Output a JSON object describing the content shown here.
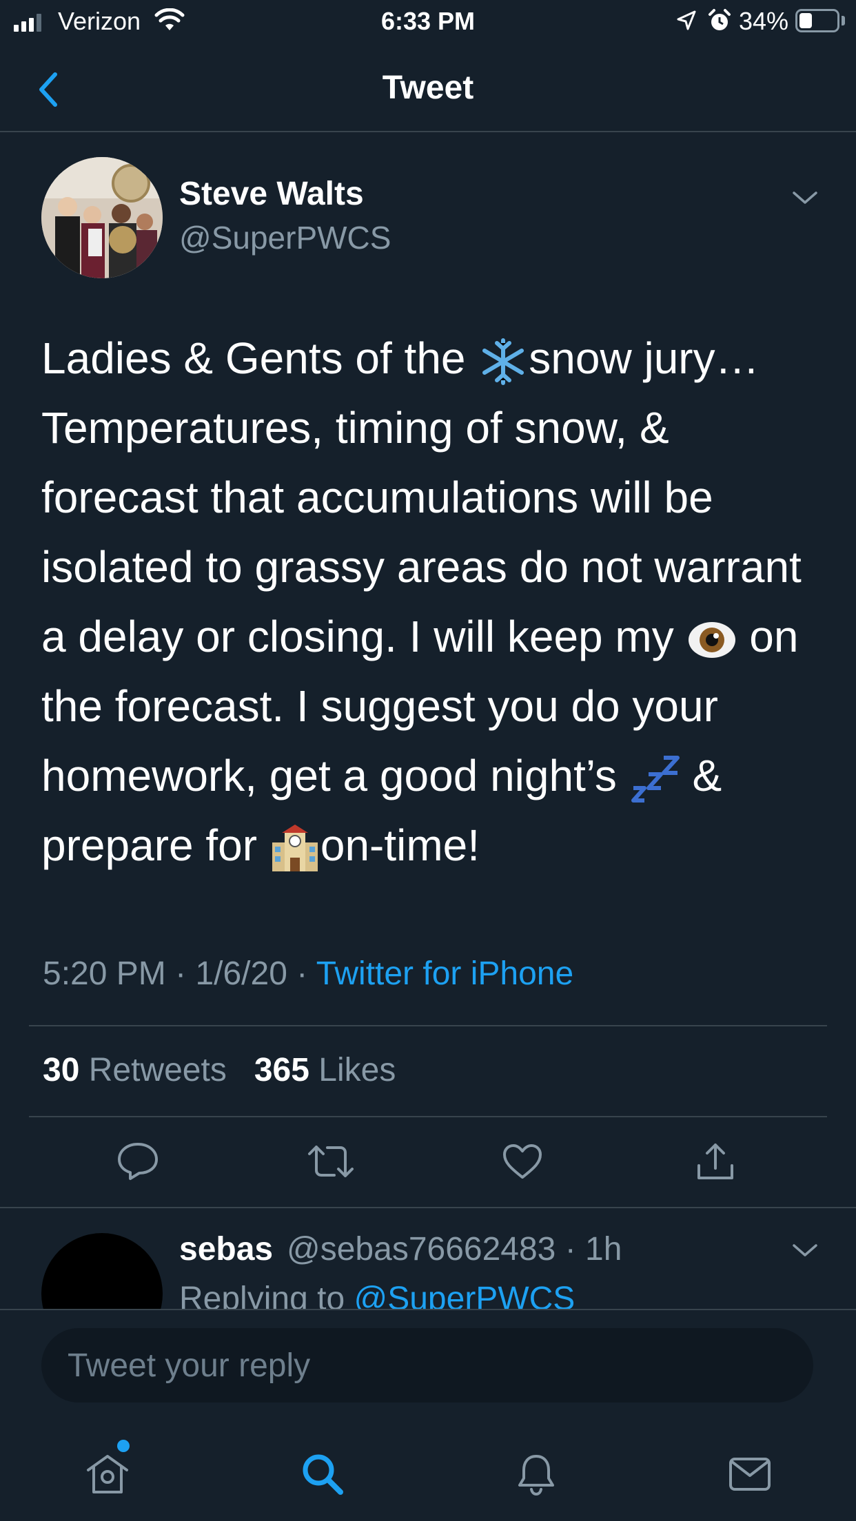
{
  "status_bar": {
    "carrier": "Verizon",
    "time": "6:33 PM",
    "battery_pct": "34%",
    "battery_level": 0.34
  },
  "nav": {
    "title": "Tweet"
  },
  "tweet": {
    "author_name": "Steve Walts",
    "author_handle": "@SuperPWCS",
    "text_parts": {
      "p1": "Ladies & Gents of the ",
      "p2": "snow jury…Temperatures, timing of snow, & forecast that accumulations will be isolated to grassy areas do not warrant a delay or closing. I will keep my ",
      "p3": " on the forecast. I suggest you do your homework, get a good night’s ",
      "p4": " & prepare for ",
      "p5": "on-time!"
    },
    "emojis": [
      "snowflake-emoji",
      "eye-emoji",
      "zzz-emoji",
      "school-emoji"
    ],
    "time": "5:20 PM",
    "date": "1/6/20",
    "separator": "·",
    "source": "Twitter for iPhone",
    "retweets_count": "30",
    "retweets_label": "Retweets",
    "likes_count": "365",
    "likes_label": "Likes"
  },
  "reply": {
    "name": "sebas",
    "handle": "@sebas76662483",
    "age": "· 1h",
    "replying_label": "Replying to",
    "replying_to": "@SuperPWCS"
  },
  "compose": {
    "placeholder": "Tweet your reply"
  },
  "colors": {
    "background": "#15202b",
    "accent": "#1da1f2",
    "secondary_text": "#8899a6",
    "divider": "#38444d"
  },
  "tabs": [
    "home-icon",
    "search-icon",
    "bell-icon",
    "mail-icon"
  ]
}
